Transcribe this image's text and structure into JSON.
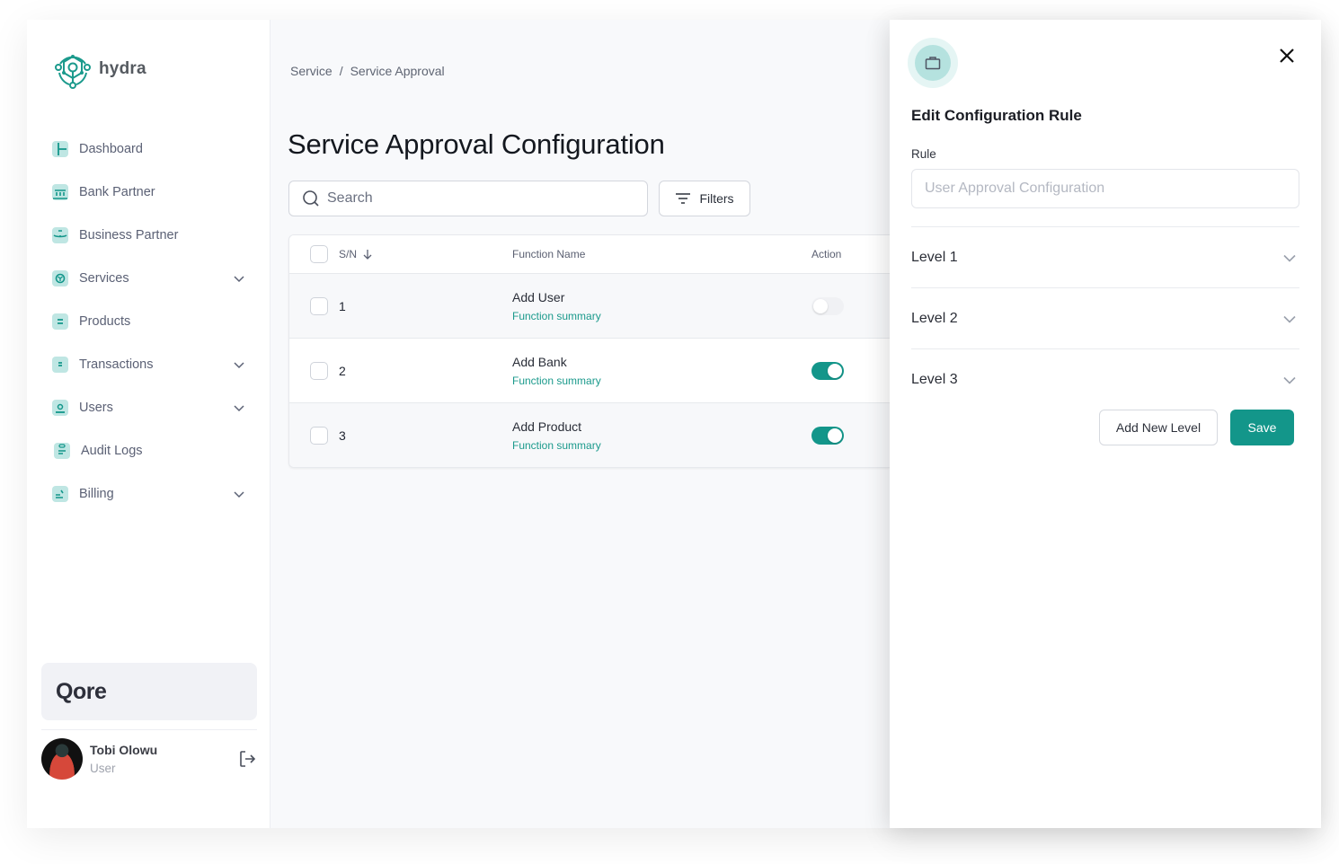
{
  "brand": {
    "name": "hydra",
    "accent_color": "#13968a",
    "logo_icon": "hydra-network-logo"
  },
  "sidebar": {
    "items": [
      {
        "label": "Dashboard",
        "icon": "dashboard-icon",
        "has_submenu": false
      },
      {
        "label": "Bank Partner",
        "icon": "bank-icon",
        "has_submenu": false
      },
      {
        "label": "Business Partner",
        "icon": "briefcase-icon",
        "has_submenu": false
      },
      {
        "label": "Services",
        "icon": "services-icon",
        "has_submenu": true
      },
      {
        "label": "Products",
        "icon": "products-icon",
        "has_submenu": false
      },
      {
        "label": "Transactions",
        "icon": "transactions-icon",
        "has_submenu": true
      },
      {
        "label": "Users",
        "icon": "user-icon",
        "has_submenu": true
      },
      {
        "label": "Audit Logs",
        "icon": "clipboard-icon",
        "has_submenu": false
      },
      {
        "label": "Billing",
        "icon": "billing-icon",
        "has_submenu": true
      }
    ],
    "organization": "Qore",
    "user": {
      "name": "Tobi Olowu",
      "role": "User"
    }
  },
  "main": {
    "breadcrumb": [
      "Service",
      "Service Approval"
    ],
    "breadcrumb_separator": "/",
    "title": "Service Approval Configuration",
    "search": {
      "placeholder": "Search",
      "value": ""
    },
    "filters_label": "Filters",
    "table": {
      "columns": {
        "sn": "S/N",
        "function_name": "Function Name",
        "action": "Action"
      },
      "rows": [
        {
          "sn": "1",
          "name": "Add User",
          "summary": "Function summary",
          "enabled": false
        },
        {
          "sn": "2",
          "name": "Add Bank",
          "summary": "Function summary",
          "enabled": true
        },
        {
          "sn": "3",
          "name": "Add Product",
          "summary": "Function summary",
          "enabled": true
        }
      ]
    }
  },
  "drawer": {
    "icon": "briefcase-icon",
    "title": "Edit Configuration Rule",
    "rule_label": "Rule",
    "rule_placeholder": "User Approval Configuration",
    "rule_value": "",
    "levels": [
      {
        "label": "Level 1"
      },
      {
        "label": "Level 2"
      },
      {
        "label": "Level 3"
      }
    ],
    "add_level_label": "Add New Level",
    "save_label": "Save"
  }
}
